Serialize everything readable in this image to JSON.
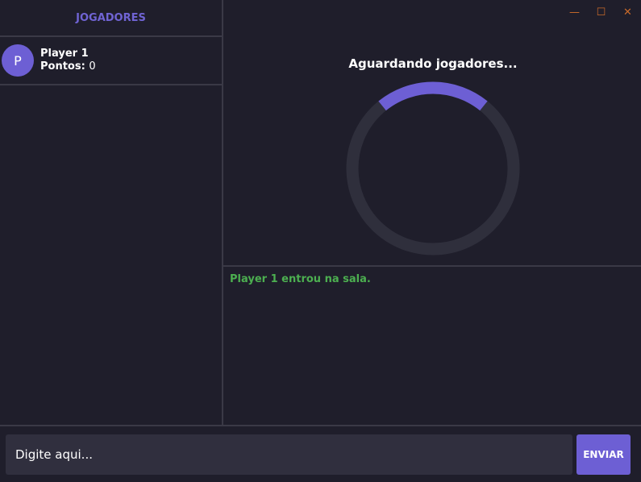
{
  "sidebar": {
    "title": "JOGADORES",
    "players": [
      {
        "initial": "P",
        "name": "Player 1",
        "score_label": "Pontos:",
        "score": "0"
      }
    ]
  },
  "window_controls": {
    "minimize": "—",
    "maximize": "☐",
    "close": "✕"
  },
  "main": {
    "status": "Aguardando jogadores...",
    "spinner_color": "#6d5fd4",
    "spinner_track_color": "#2f2f3c"
  },
  "chat": {
    "messages": [
      {
        "text": "Player 1 entrou na sala.",
        "color": "#4caf50"
      }
    ]
  },
  "input": {
    "placeholder": "Digite aqui...",
    "send_label": "ENVIAR"
  },
  "colors": {
    "background": "#1f1e2b",
    "accent": "#6d5fd4",
    "border": "#3a3946"
  }
}
